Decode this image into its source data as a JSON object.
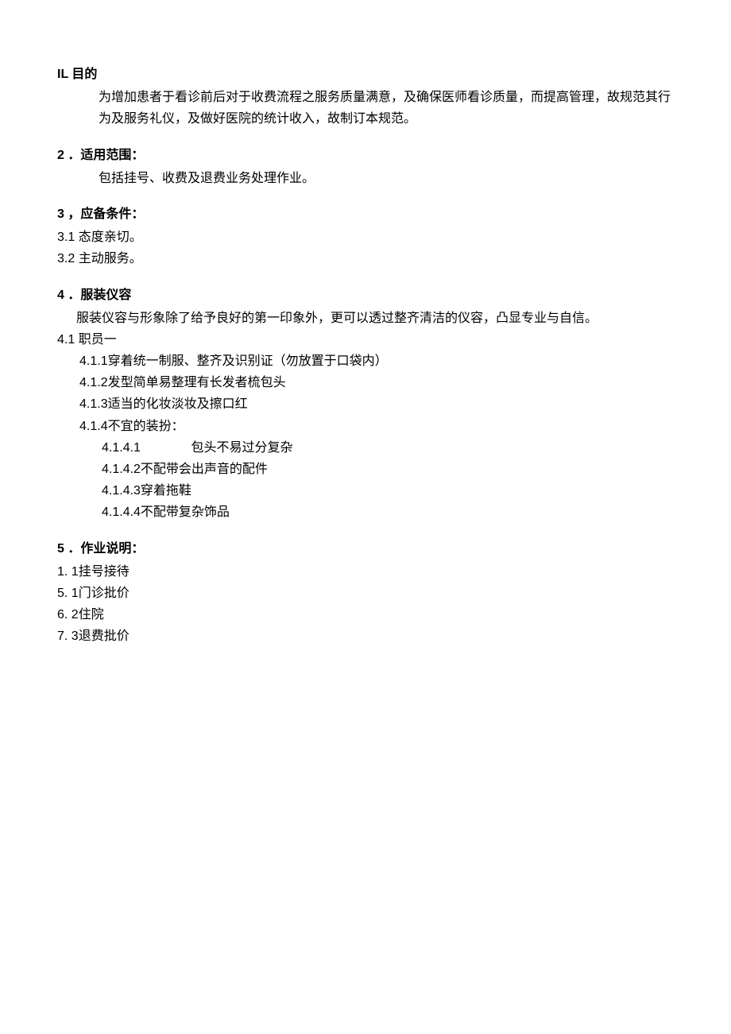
{
  "s1": {
    "heading": "IL 目的",
    "p1": "为增加患者于看诊前后对于收费流程之服务质量满意，及确保医师看诊质量，而提高管理，故规范其行为及服务礼仪，及做好医院的统计收入，故制订本规范。"
  },
  "s2": {
    "heading": "2 ．适用范围：",
    "p1": "包括挂号、收费及退费业务处理作业。"
  },
  "s3": {
    "heading": "3 ，应备条件：",
    "i1": "3.1 态度亲切。",
    "i2": "3.2 主动服务。"
  },
  "s4": {
    "heading": "4 ．服装仪容",
    "p1": "服装仪容与形象除了给予良好的第一印象外，更可以透过整齐清洁的仪容，凸显专业与自信。",
    "i1": "4.1 职员一",
    "i1_1": "4.1.1穿着统一制服、整齐及识别证（勿放置于口袋内）",
    "i1_2": "4.1.2发型简单易整理有长发者梳包头",
    "i1_3": "4.1.3适当的化妆淡妆及擦口红",
    "i1_4": "4.1.4不宜的装扮：",
    "i1_4_1_num": "4.1.4.1",
    "i1_4_1_txt": "包头不易过分复杂",
    "i1_4_2": "4.1.4.2不配带会出声音的配件",
    "i1_4_3": "4.1.4.3穿着拖鞋",
    "i1_4_4": "4.1.4.4不配带复杂饰品"
  },
  "s5": {
    "heading": "5 ．作业说明：",
    "i1": "1. 1挂号接待",
    "i2": "5. 1门诊批价",
    "i3": "6. 2住院",
    "i4": "7. 3退费批价"
  }
}
